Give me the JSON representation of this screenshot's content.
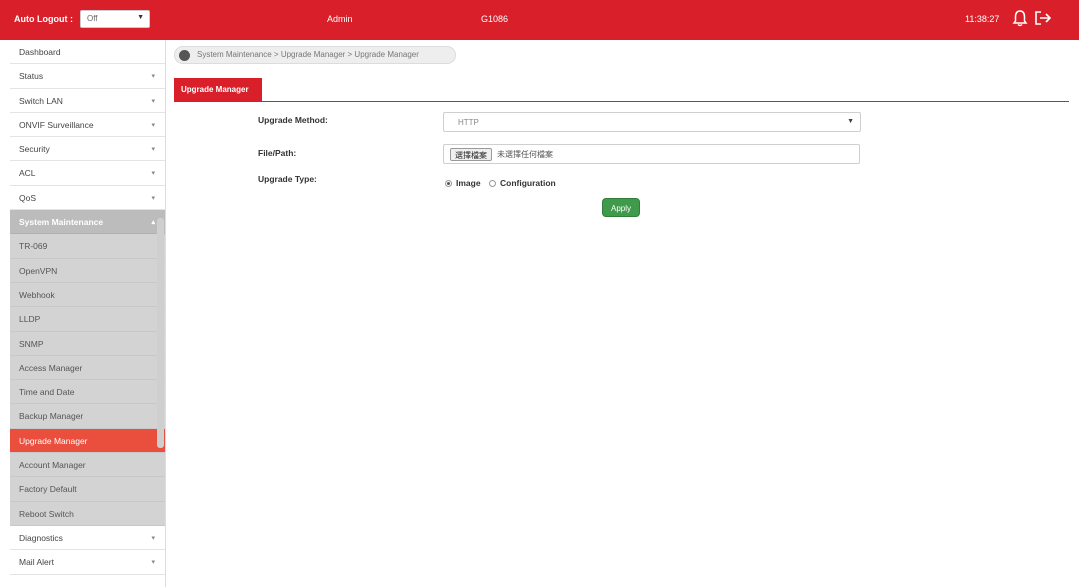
{
  "header": {
    "auto_logout_label": "Auto Logout :",
    "auto_logout_value": "Off",
    "user": "Admin",
    "device": "G1086",
    "clock": "11:38:27"
  },
  "sidebar": {
    "items": [
      {
        "label": "Dashboard",
        "chevron": ""
      },
      {
        "label": "Status",
        "chevron": "▾"
      },
      {
        "label": "Switch LAN",
        "chevron": "▾"
      },
      {
        "label": "ONVIF Surveillance",
        "chevron": "▾"
      },
      {
        "label": "Security",
        "chevron": "▾"
      },
      {
        "label": "ACL",
        "chevron": "▾"
      },
      {
        "label": "QoS",
        "chevron": "▾"
      },
      {
        "label": "System Maintenance",
        "chevron": "▴"
      },
      {
        "label": "TR-069",
        "chevron": ""
      },
      {
        "label": "OpenVPN",
        "chevron": ""
      },
      {
        "label": "Webhook",
        "chevron": ""
      },
      {
        "label": "LLDP",
        "chevron": ""
      },
      {
        "label": "SNMP",
        "chevron": ""
      },
      {
        "label": "Access Manager",
        "chevron": ""
      },
      {
        "label": "Time and Date",
        "chevron": ""
      },
      {
        "label": "Backup Manager",
        "chevron": ""
      },
      {
        "label": "Upgrade Manager",
        "chevron": ""
      },
      {
        "label": "Account Manager",
        "chevron": ""
      },
      {
        "label": "Factory Default",
        "chevron": ""
      },
      {
        "label": "Reboot Switch",
        "chevron": ""
      },
      {
        "label": "Diagnostics",
        "chevron": "▾"
      },
      {
        "label": "Mail Alert",
        "chevron": "▾"
      }
    ]
  },
  "breadcrumb": "System Maintenance > Upgrade Manager > Upgrade Manager",
  "tab": "Upgrade Manager",
  "form": {
    "method_label": "Upgrade Method:",
    "method_value": "HTTP",
    "file_label": "File/Path:",
    "file_button": "選擇檔案",
    "file_status": "未選擇任何檔案",
    "type_label": "Upgrade Type:",
    "type_options": [
      "Image",
      "Configuration"
    ],
    "apply": "Apply"
  },
  "colors": {
    "brand_red": "#d9202a",
    "active_item": "#ea4e3d",
    "apply_green": "#3f9a4b"
  }
}
